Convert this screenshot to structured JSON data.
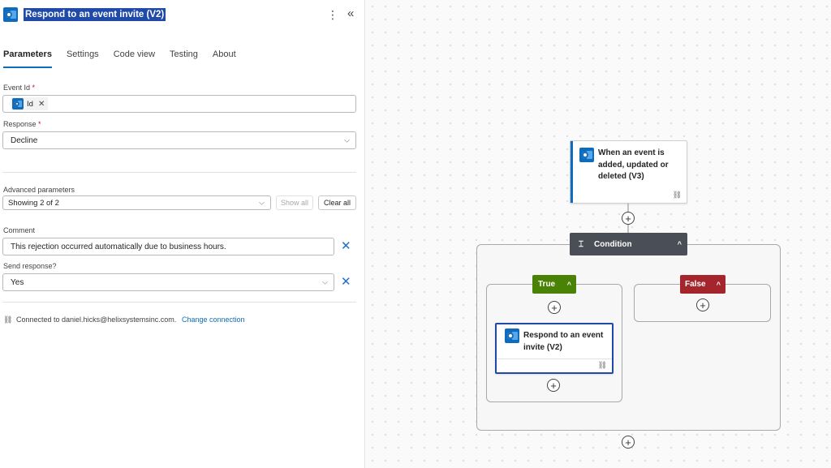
{
  "panel": {
    "title": "Respond to an event invite (V2)",
    "more_glyph": "⋮",
    "collapse_glyph": "«",
    "tabs": [
      "Parameters",
      "Settings",
      "Code view",
      "Testing",
      "About"
    ],
    "event_id": {
      "label": "Event Id",
      "required": "*",
      "chip": "Id",
      "chip_remove": "✕"
    },
    "response": {
      "label": "Response",
      "required": "*",
      "value": "Decline"
    },
    "advanced": {
      "label": "Advanced parameters",
      "value": "Showing 2 of 2",
      "show_all": "Show all",
      "clear_all": "Clear all"
    },
    "comment": {
      "label": "Comment",
      "value": "This rejection occurred automatically due to business hours."
    },
    "send_response": {
      "label": "Send response?",
      "value": "Yes"
    },
    "clear_glyph": "✕",
    "chevron_glyph": "⌵",
    "connection": {
      "text": "Connected to daniel.hicks@helixsystemsinc.com.",
      "link": "Change connection"
    }
  },
  "canvas": {
    "trigger_title": "When an event is added, updated or deleted (V3)",
    "condition_title": "Condition",
    "true_label": "True",
    "false_label": "False",
    "action_title": "Respond to an event invite (V2)",
    "plus_glyph": "+",
    "link_glyph": "⛓",
    "caret_glyph": "^"
  },
  "colors": {
    "accent": "#0f6cbd",
    "true_green": "#498205",
    "false_red": "#a4262c",
    "condition_gray": "#4a4e57"
  }
}
